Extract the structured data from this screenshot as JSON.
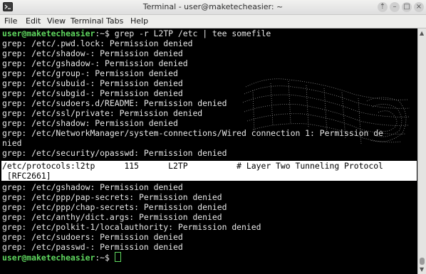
{
  "window": {
    "title": "Terminal - user@maketecheasier: ~",
    "controls": {
      "shade": "⇡",
      "minimize": "–",
      "maximize": "□",
      "close": "×"
    }
  },
  "menu": [
    "File",
    "Edit",
    "View",
    "Terminal",
    "Tabs",
    "Help"
  ],
  "colors": {
    "prompt_user": "#5fd75f",
    "terminal_bg": "#000000",
    "text": "#e8e8e8",
    "highlight_bg": "#ffffff"
  },
  "terminal": {
    "prompt_user": "user@maketecheasier",
    "prompt_path": ":~$ ",
    "command": "grep -r L2TP /etc | tee somefile",
    "output": [
      "grep: /etc/.pwd.lock: Permission denied",
      "grep: /etc/shadow-: Permission denied",
      "grep: /etc/gshadow-: Permission denied",
      "grep: /etc/group-: Permission denied",
      "grep: /etc/subuid-: Permission denied",
      "grep: /etc/subgid-: Permission denied",
      "grep: /etc/sudoers.d/README: Permission denied",
      "grep: /etc/ssl/private: Permission denied",
      "grep: /etc/shadow: Permission denied",
      "grep: /etc/NetworkManager/system-connections/Wired connection 1: Permission de",
      "nied",
      "grep: /etc/security/opasswd: Permission denied"
    ],
    "highlighted": [
      "/etc/protocols:l2tp      115      L2TP          # Layer Two Tunneling Protocol",
      " [RFC2661]"
    ],
    "output_after": [
      "grep: /etc/gshadow: Permission denied",
      "grep: /etc/ppp/pap-secrets: Permission denied",
      "grep: /etc/ppp/chap-secrets: Permission denied",
      "grep: /etc/anthy/dict.args: Permission denied",
      "grep: /etc/polkit-1/localauthority: Permission denied",
      "grep: /etc/sudoers: Permission denied",
      "grep: /etc/passwd-: Permission denied"
    ]
  }
}
